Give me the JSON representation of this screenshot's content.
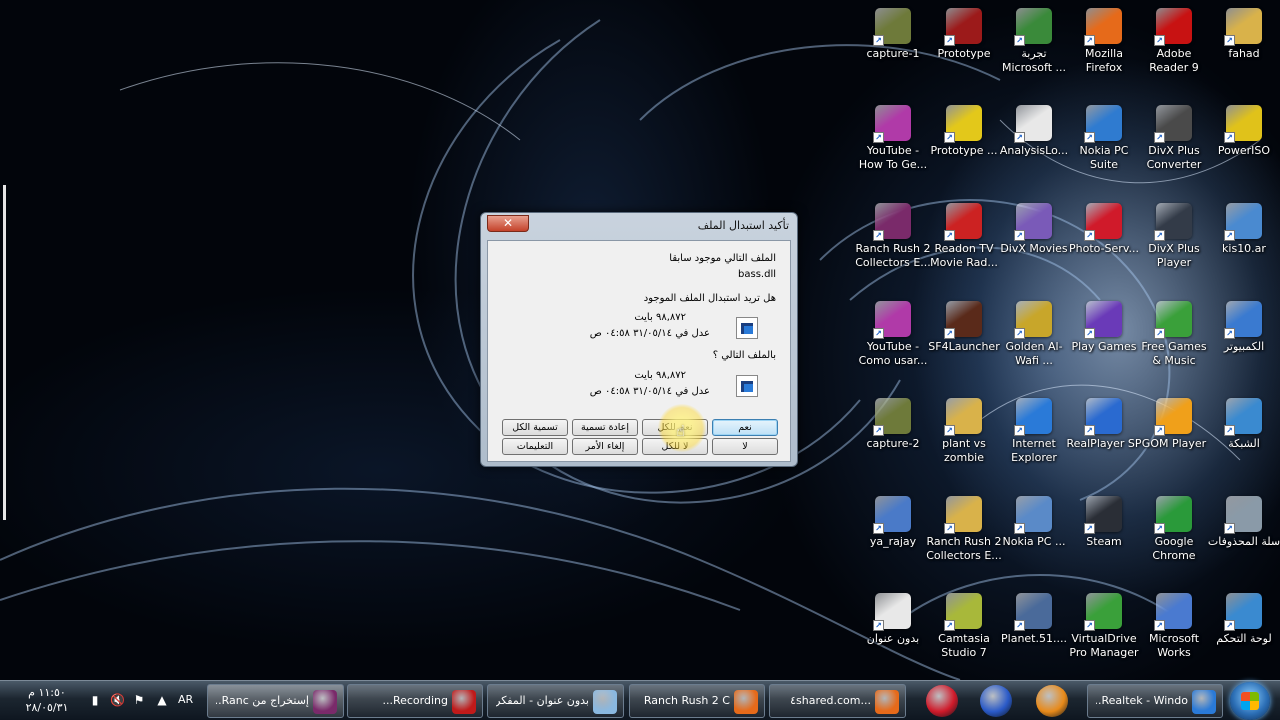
{
  "desktop_icons": [
    {
      "label": "capture-1",
      "icon": "video-file-icon",
      "color": "#6e7a3a"
    },
    {
      "label": "Prototype",
      "icon": "prototype-game-icon",
      "color": "#9c1a1a"
    },
    {
      "label": "تجربة Microsoft ...",
      "icon": "media-file-icon",
      "color": "#3a8a3a"
    },
    {
      "label": "Mozilla Firefox",
      "icon": "firefox-icon",
      "color": "#e66a1a"
    },
    {
      "label": "Adobe Reader 9",
      "icon": "adobe-reader-icon",
      "color": "#c81212"
    },
    {
      "label": "fahad",
      "icon": "folder-icon",
      "color": "#d9b24a"
    },
    {
      "label": "YouTube - How To Ge...",
      "icon": "flv-file-icon",
      "color": "#b03aa8"
    },
    {
      "label": "Prototype ...",
      "icon": "disc-icon",
      "color": "#e3c81a"
    },
    {
      "label": "AnalysisLo...",
      "icon": "text-file-icon",
      "color": "#e8e8e8"
    },
    {
      "label": "Nokia PC Suite",
      "icon": "nokia-pc-suite-icon",
      "color": "#2f7bd0"
    },
    {
      "label": "DivX Plus Converter",
      "icon": "divx-converter-icon",
      "color": "#4a4a4a"
    },
    {
      "label": "PowerISO",
      "icon": "poweriso-icon",
      "color": "#e0c21a"
    },
    {
      "label": "Ranch Rush 2 Collectors E...",
      "icon": "winrar-icon",
      "color": "#7a2a6a"
    },
    {
      "label": "Readon TV Movie Rad...",
      "icon": "readon-tv-icon",
      "color": "#cc2222"
    },
    {
      "label": "DivX Movies",
      "icon": "divx-movies-icon",
      "color": "#7a5ab8"
    },
    {
      "label": "Photo-Serv...",
      "icon": "photo-service-icon",
      "color": "#d01a2a"
    },
    {
      "label": "DivX Plus Player",
      "icon": "divx-player-icon",
      "color": "#333b48"
    },
    {
      "label": "kis10.ar",
      "icon": "installer-icon",
      "color": "#4a8ad0"
    },
    {
      "label": "YouTube - Como usar...",
      "icon": "flv-file-icon",
      "color": "#b03aa8"
    },
    {
      "label": "SF4Launcher",
      "icon": "sf4-launcher-icon",
      "color": "#5a2a1a"
    },
    {
      "label": "Golden Al-Wafi ...",
      "icon": "golden-alwafi-icon",
      "color": "#c8a62a"
    },
    {
      "label": "Play Games",
      "icon": "play-games-icon",
      "color": "#6a3ab8"
    },
    {
      "label": "Free Games & Music",
      "icon": "gift-icon",
      "color": "#3aa03a"
    },
    {
      "label": "الكمبيوتر",
      "icon": "computer-icon",
      "color": "#3a7ad0"
    },
    {
      "label": "capture-2",
      "icon": "video-file-icon",
      "color": "#6e7a3a"
    },
    {
      "label": "plant vs zombie",
      "icon": "folder-icon",
      "color": "#d9b24a"
    },
    {
      "label": "Internet Explorer",
      "icon": "internet-explorer-icon",
      "color": "#2a7ad8"
    },
    {
      "label": "RealPlayer SP",
      "icon": "realplayer-icon",
      "color": "#2a6ad0"
    },
    {
      "label": "GOM Player",
      "icon": "gom-player-icon",
      "color": "#f0a01a"
    },
    {
      "label": "الشبكة",
      "icon": "network-icon",
      "color": "#3a8ad0"
    },
    {
      "label": "ya_rajay",
      "icon": "audio-file-icon",
      "color": "#4a7ac8"
    },
    {
      "label": "Ranch Rush 2 Collectors E...",
      "icon": "folder-icon",
      "color": "#d9b24a"
    },
    {
      "label": "Nokia PC ...",
      "icon": "installer-icon",
      "color": "#5a8ac8"
    },
    {
      "label": "Steam",
      "icon": "steam-icon",
      "color": "#2a2e36"
    },
    {
      "label": "Google Chrome",
      "icon": "chrome-icon",
      "color": "#2a9a3a"
    },
    {
      "label": "سلة المحذوفات",
      "icon": "recycle-bin-icon",
      "color": "#8a9aa8"
    },
    {
      "label": "بدون عنوان",
      "icon": "wma-file-icon",
      "color": "#e8e8e8"
    },
    {
      "label": "Camtasia Studio 7",
      "icon": "camtasia-icon",
      "color": "#a8b83a"
    },
    {
      "label": "Planet.51....",
      "icon": "planet51-icon",
      "color": "#4a6a9a"
    },
    {
      "label": "VirtualDrive Pro Manager",
      "icon": "virtualdrive-icon",
      "color": "#3aa03a"
    },
    {
      "label": "Microsoft Works",
      "icon": "microsoft-works-icon",
      "color": "#4a7ad0"
    },
    {
      "label": "لوحة التحكم",
      "icon": "control-panel-icon",
      "color": "#3a8ad0"
    }
  ],
  "dialog": {
    "title": "تأكيد استبدال الملف",
    "close_label": "✕",
    "existing_text": "الملف التالي موجود سابقا",
    "filename": "bass.dll",
    "question": "هل تريد استبدال الملف الموجود",
    "existing_size": "٩٨,٨٧٢ بايت",
    "existing_modified": "عدل في ٣١/٠٥/١٤ ٠٤:٥٨ ص",
    "with_text": "بالملف التالي ؟",
    "new_size": "٩٨,٨٧٢ بايت",
    "new_modified": "عدل في ٣١/٠٥/١٤ ٠٤:٥٨ ص",
    "buttons": {
      "yes": "نعم",
      "yes_all": "نعم للكل",
      "rename": "إعادة تسمية",
      "rename_all": "تسمية الكل",
      "no": "لا",
      "no_all": "لا للكل",
      "cancel": "إلغاء الأمر",
      "help": "التعليمات"
    }
  },
  "taskbar": {
    "time": "١١:٥٠ م",
    "date": "٢٨/٠٥/٣١",
    "language": "AR",
    "tasks": [
      {
        "label": "إستخراج من Ranc...",
        "icon": "winrar-icon",
        "color": "#7a2a6a"
      },
      {
        "label": "Recording...",
        "icon": "recording-icon",
        "color": "#c01a1a"
      },
      {
        "label": "بدون عنوان - المفكرة",
        "icon": "notepad-icon",
        "color": "#8ab8e0"
      },
      {
        "label": "Ranch Rush 2 C",
        "icon": "firefox-icon",
        "color": "#e66a1a"
      },
      {
        "label": "...٤shared.com",
        "icon": "firefox-icon",
        "color": "#e66a1a"
      },
      {
        "label": "Realtek - Windo...",
        "icon": "internet-explorer-icon",
        "color": "#2a7ad8"
      }
    ],
    "pinned": [
      {
        "icon": "pin-icon",
        "color": "#d01a2a"
      },
      {
        "icon": "user-icon",
        "color": "#2a5ac8"
      },
      {
        "icon": "media-player-icon",
        "color": "#e88a1a"
      }
    ]
  }
}
